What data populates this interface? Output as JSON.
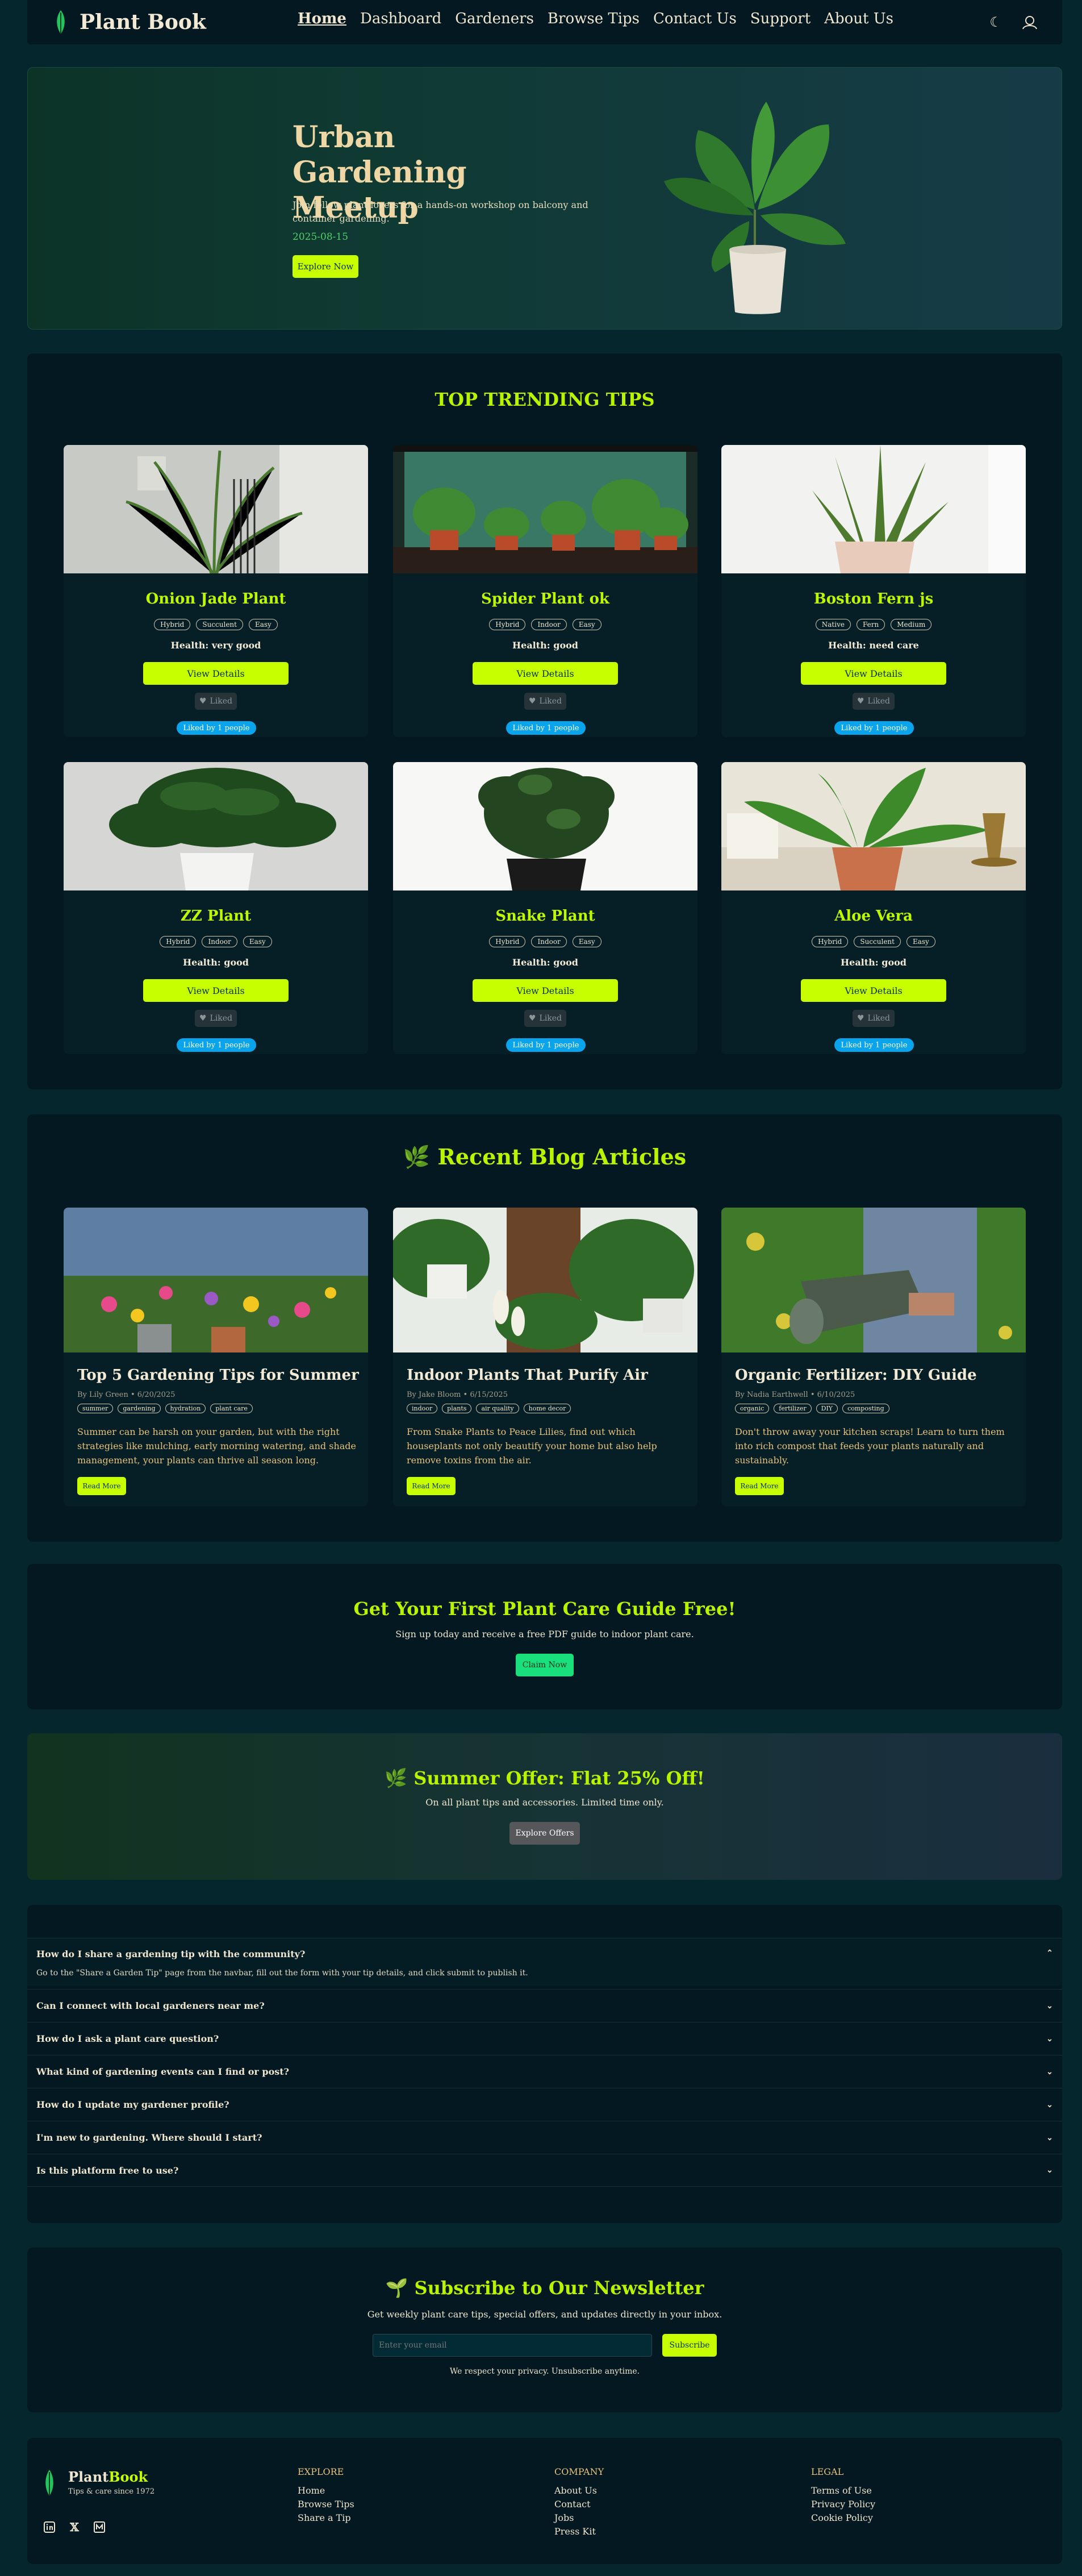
{
  "nav": {
    "brand": "Plant Book",
    "links": [
      "Home",
      "Dashboard",
      "Gardeners",
      "Browse Tips",
      "Contact Us",
      "Support",
      "About Us"
    ],
    "theme_icon": "moon-icon",
    "user_icon": "user-avatar-icon"
  },
  "hero": {
    "title": "Urban Gardening Meetup",
    "desc": "Join fellow plant lovers for a hands-on workshop on balcony and container gardening.",
    "date": "2025-08-15",
    "cta": "Explore Now"
  },
  "tips": {
    "title": "TOP TRENDING TIPS",
    "cards": [
      {
        "name": "Onion Jade Plant",
        "tags": [
          "Hybrid",
          "Succulent",
          "Easy"
        ],
        "health": "Health: very good"
      },
      {
        "name": "Spider Plant ok",
        "tags": [
          "Hybrid",
          "Indoor",
          "Easy"
        ],
        "health": "Health: good"
      },
      {
        "name": "Boston Fern js",
        "tags": [
          "Native",
          "Fern",
          "Medium"
        ],
        "health": "Health: need care"
      },
      {
        "name": "ZZ Plant",
        "tags": [
          "Hybrid",
          "Indoor",
          "Easy"
        ],
        "health": "Health: good"
      },
      {
        "name": "Snake Plant",
        "tags": [
          "Hybrid",
          "Indoor",
          "Easy"
        ],
        "health": "Health: good"
      },
      {
        "name": "Aloe Vera",
        "tags": [
          "Hybrid",
          "Succulent",
          "Easy"
        ],
        "health": "Health: good"
      }
    ],
    "details_label": "View Details",
    "liked_label": "Liked",
    "liked_by": "Liked by 1 people"
  },
  "blog": {
    "title": "🌿 Recent Blog Articles",
    "posts": [
      {
        "title": "Top 5 Gardening Tips for Summer",
        "meta": "By Lily Green • 6/20/2025",
        "tags": [
          "summer",
          "gardening",
          "hydration",
          "plant care"
        ],
        "excerpt": "Summer can be harsh on your garden, but with the right strategies like mulching, early morning watering, and shade management, your plants can thrive all season long."
      },
      {
        "title": "Indoor Plants That Purify Air",
        "meta": "By Jake Bloom • 6/15/2025",
        "tags": [
          "indoor",
          "plants",
          "air quality",
          "home decor"
        ],
        "excerpt": "From Snake Plants to Peace Lilies, find out which houseplants not only beautify your home but also help remove toxins from the air."
      },
      {
        "title": "Organic Fertilizer: DIY Guide",
        "meta": "By Nadia Earthwell • 6/10/2025",
        "tags": [
          "organic",
          "fertilizer",
          "DIY",
          "composting"
        ],
        "excerpt": "Don't throw away your kitchen scraps! Learn to turn them into rich compost that feeds your plants naturally and sustainably."
      }
    ],
    "read_more": "Read More"
  },
  "guide": {
    "title": "Get Your First Plant Care Guide Free!",
    "desc": "Sign up today and receive a free PDF guide to indoor plant care.",
    "cta": "Claim Now"
  },
  "offer": {
    "title": "🌿 Summer Offer: Flat 25% Off!",
    "desc": "On all plant tips and accessories. Limited time only.",
    "cta": "Explore Offers"
  },
  "faq": {
    "items": [
      {
        "q": "How do I share a gardening tip with the community?",
        "a": "Go to the \"Share a Garden Tip\" page from the navbar, fill out the form with your tip details, and click submit to publish it."
      },
      {
        "q": "Can I connect with local gardeners near me?"
      },
      {
        "q": "How do I ask a plant care question?"
      },
      {
        "q": "What kind of gardening events can I find or post?"
      },
      {
        "q": "How do I update my gardener profile?"
      },
      {
        "q": "I'm new to gardening. Where should I start?"
      },
      {
        "q": "Is this platform free to use?"
      }
    ]
  },
  "newsletter": {
    "title": "🌱 Subscribe to Our Newsletter",
    "desc": "Get weekly plant care tips, special offers, and updates directly in your inbox.",
    "placeholder": "Enter your email",
    "cta": "Subscribe",
    "note": "We respect your privacy. Unsubscribe anytime."
  },
  "footer": {
    "brand_a": "Plant",
    "brand_b": "Book",
    "tagline": "Tips & care since 1972",
    "explore": {
      "title": "EXPLORE",
      "links": [
        "Home",
        "Browse Tips",
        "Share a Tip"
      ]
    },
    "company": {
      "title": "COMPANY",
      "links": [
        "About Us",
        "Contact",
        "Jobs",
        "Press Kit"
      ]
    },
    "legal": {
      "title": "LEGAL",
      "links": [
        "Terms of Use",
        "Privacy Policy",
        "Cookie Policy"
      ]
    },
    "social": [
      "linkedin-icon",
      "x-icon",
      "medium-icon"
    ]
  },
  "colors": {
    "accent": "#c7ff00",
    "title": "#b9f300",
    "bg": "#06262d",
    "panel": "#031820",
    "pill": "#0aa4ec"
  }
}
